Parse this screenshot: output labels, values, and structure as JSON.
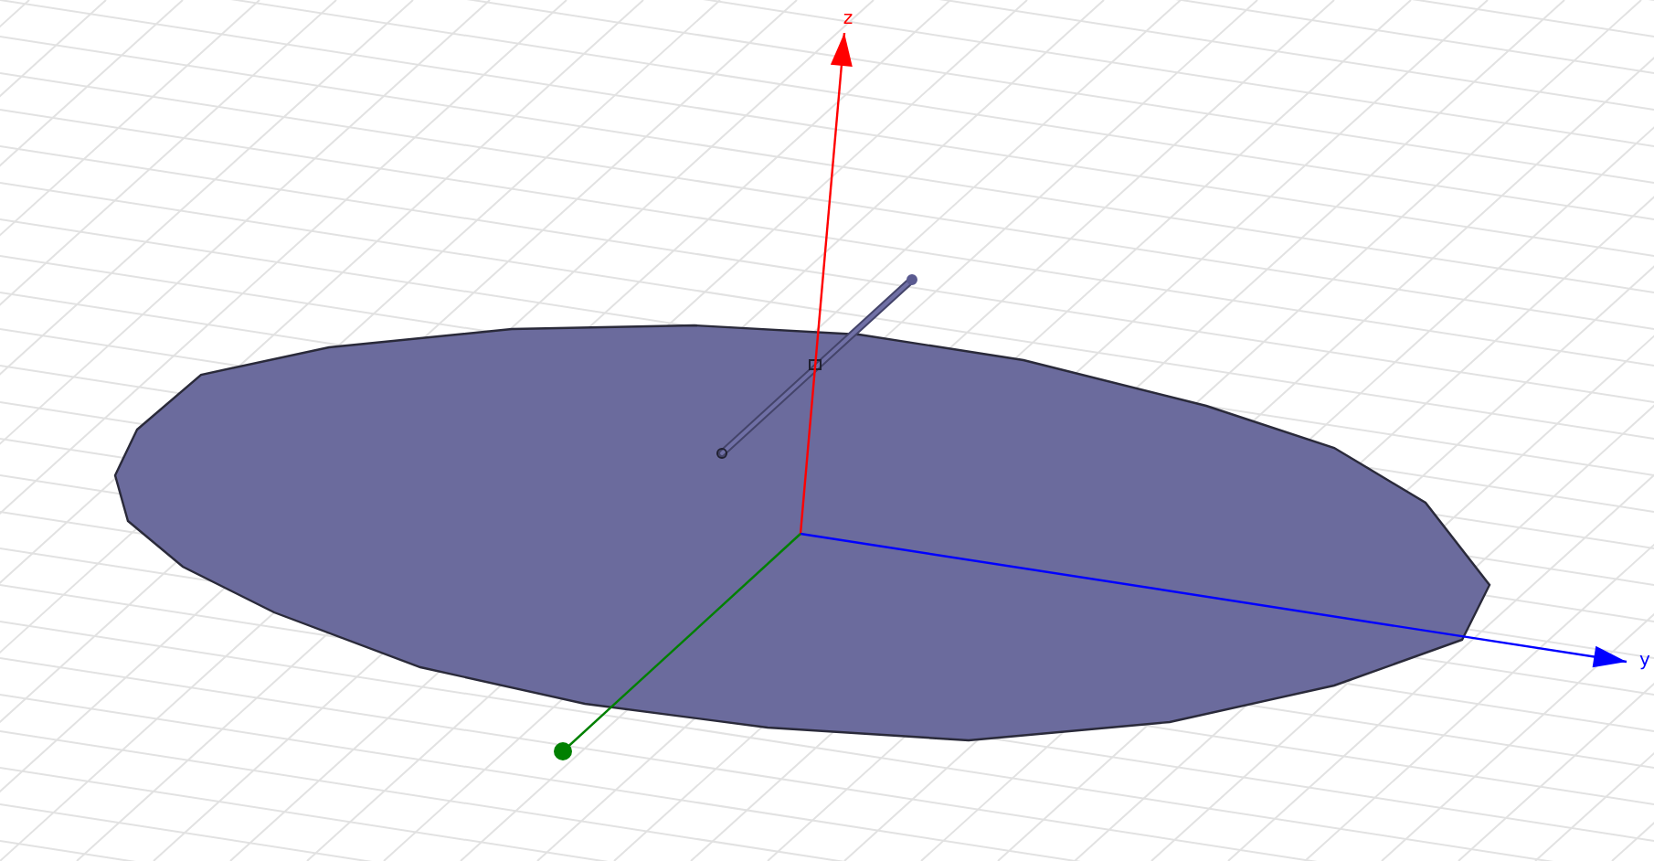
{
  "viewport": {
    "axes": [
      {
        "kind": "z",
        "label": "z",
        "color": "#ff0000"
      },
      {
        "kind": "y",
        "label": "y",
        "color": "#0000ff"
      },
      {
        "kind": "x",
        "color": "#008000"
      }
    ]
  }
}
